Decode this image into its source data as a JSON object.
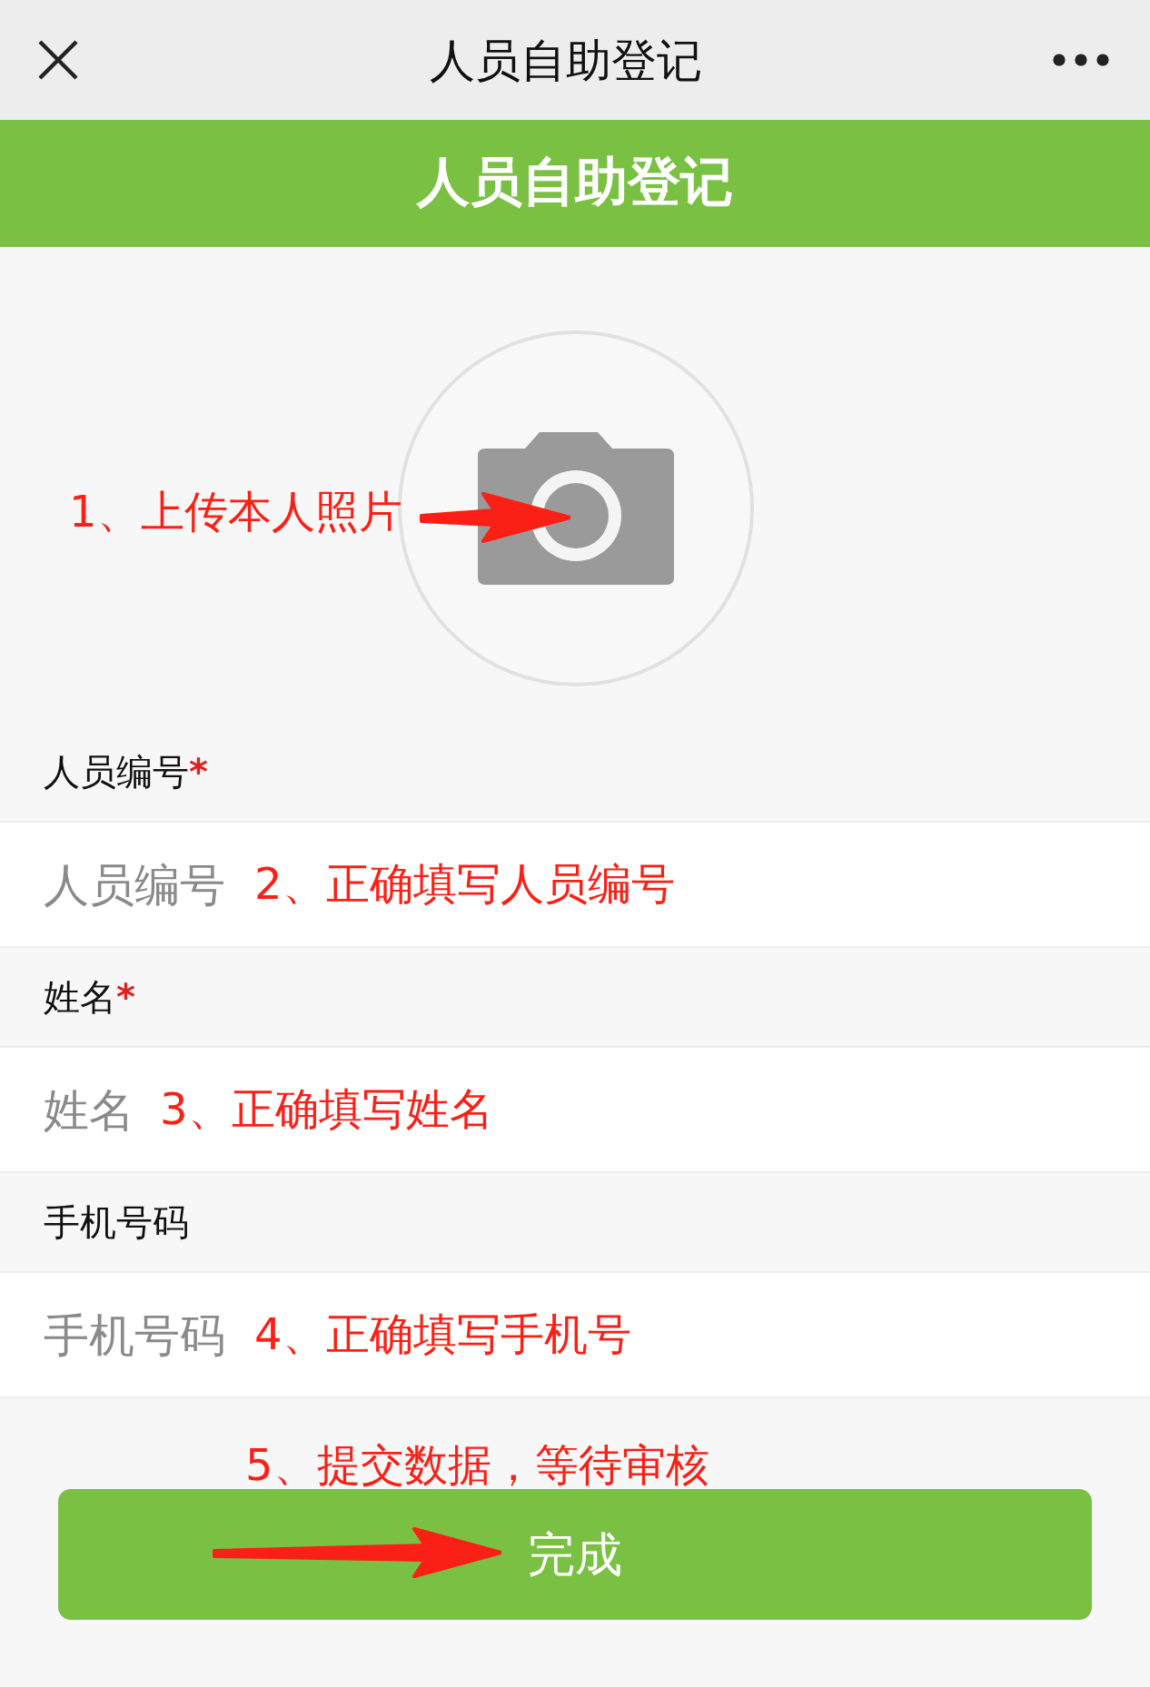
{
  "nav": {
    "title": "人员自助登记"
  },
  "header": {
    "title": "人员自助登记"
  },
  "photo": {
    "annotation": "1、上传本人照片"
  },
  "fields": [
    {
      "label": "人员编号",
      "marker": "*",
      "placeholder": "人员编号",
      "annotation": "2、正确填写人员编号"
    },
    {
      "label": "姓名",
      "marker": "*",
      "placeholder": "姓名",
      "annotation": "3、正确填写姓名"
    },
    {
      "label": "手机号码",
      "placeholder": "手机号码",
      "annotation": "4、正确填写手机号"
    }
  ],
  "submit": {
    "label": "完成",
    "annotation": "5、提交数据，等待审核"
  }
}
